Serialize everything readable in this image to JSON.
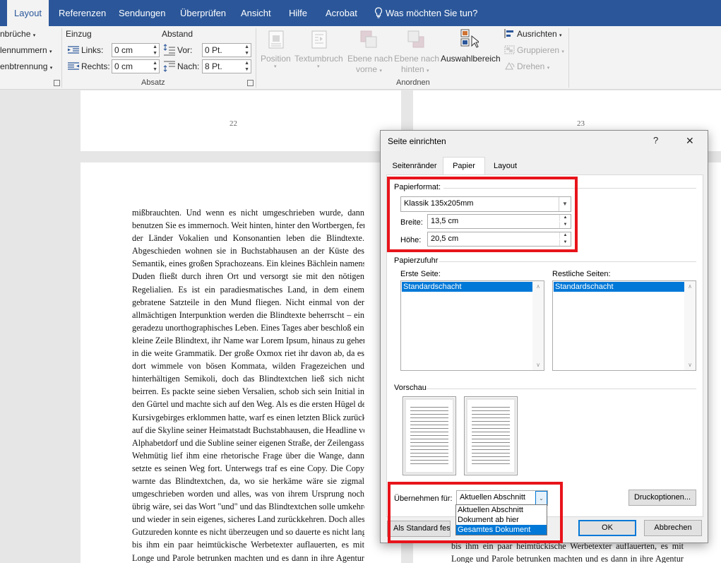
{
  "tabs": [
    {
      "label": "Layout",
      "active": true
    },
    {
      "label": "Referenzen"
    },
    {
      "label": "Sendungen"
    },
    {
      "label": "Überprüfen"
    },
    {
      "label": "Ansicht"
    },
    {
      "label": "Hilfe"
    },
    {
      "label": "Acrobat"
    }
  ],
  "tell_me": "Was möchten Sie tun?",
  "ribbon": {
    "left_items": [
      "nbrüche",
      "lennummern",
      "enbtrennung"
    ],
    "einzug_title": "Einzug",
    "abstand_title": "Abstand",
    "links_label": "Links:",
    "links_value": "0 cm",
    "rechts_label": "Rechts:",
    "rechts_value": "0 cm",
    "vor_label": "Vor:",
    "vor_value": "0 Pt.",
    "nach_label": "Nach:",
    "nach_value": "8 Pt.",
    "absatz_label": "Absatz",
    "position": "Position",
    "textumbruch": "Textumbruch",
    "ebene_vorne_1": "Ebene nach",
    "ebene_vorne_2": "vorne",
    "ebene_hinten_1": "Ebene nach",
    "ebene_hinten_2": "hinten",
    "auswahlbereich": "Auswahlbereich",
    "ausrichten": "Ausrichten",
    "gruppieren": "Gruppieren",
    "drehen": "Drehen",
    "anordnen_label": "Anordnen"
  },
  "doc": {
    "page_left": "22",
    "page_right": "23",
    "lines": [
      "mißbrauchten. Und wenn es nicht umgeschrieben wurde, dann",
      "benutzen Sie es immernoch. Weit hinten, hinter den Wortbergen, fern",
      "der Länder Vokalien und Konsonantien leben die Blindtexte.",
      "Abgeschieden wohnen sie in Buchstabhausen an der Küste des",
      "Semantik, eines großen Sprachozeans. Ein kleines Bächlein namens",
      "Duden fließt durch ihren Ort und versorgt sie mit den nötigen",
      "Regelialien. Es ist ein paradiesmatisches Land, in dem einem",
      "gebratene Satzteile in den Mund fliegen. Nicht einmal von der",
      "allmächtigen Interpunktion werden die Blindtexte beherrscht – ein",
      "geradezu unorthographisches Leben. Eines Tages aber beschloß eine",
      "kleine Zeile Blindtext, ihr Name war Lorem Ipsum, hinaus zu gehen",
      "in die weite Grammatik. Der große Oxmox riet ihr davon ab, da es",
      "dort wimmele von bösen Kommata, wilden Fragezeichen und",
      "hinterhältigen Semikoli, doch das Blindtextchen ließ sich nicht",
      "beirren. Es packte seine sieben Versalien, schob sich sein Initial in",
      "den Gürtel und machte sich auf den Weg. Als es die ersten Hügel des",
      "Kursivgebirges erklommen hatte, warf es einen letzten Blick zurück",
      "auf die Skyline seiner Heimatstadt Buchstabhausen, die Headline von",
      "Alphabetdorf und die Subline seiner eigenen Straße, der Zeilengasse.",
      "Wehmütig lief ihm eine rhetorische Frage über die Wange, dann",
      "setzte es seinen Weg fort. Unterwegs traf es eine Copy. Die Copy",
      "warnte das Blindtextchen, da, wo sie herkäme wäre sie zigmal",
      "umgeschrieben worden und alles, was von ihrem Ursprung noch",
      "übrig wäre, sei das Wort \"und\" und das Blindtextchen solle umkehren",
      "und wieder in sein eigenes, sicheres Land zurückkehren. Doch alles",
      "Gutzureden konnte es nicht überzeugen und so dauerte es nicht lange,",
      "bis ihm ein paar heimtückische Werbetexter auflauerten, es mit",
      "Longe und Parole betrunken machten und es dann in ihre Agentur"
    ],
    "right_lines": [
      "bis ihm ein paar heimtückische Werbetexter auflauerten, es mit",
      "Longe und Parole betrunken machten und es dann in ihre Agentur"
    ]
  },
  "dialog": {
    "title": "Seite einrichten",
    "help": "?",
    "close": "✕",
    "tabs": [
      "Seitenränder",
      "Papier",
      "Layout"
    ],
    "papierformat_label": "Papierformat:",
    "papierformat_value": "Klassik 135x205mm",
    "breite_label": "Breite:",
    "breite_value": "13,5 cm",
    "hoehe_label": "Höhe:",
    "hoehe_value": "20,5 cm",
    "papierzufuhr_label": "Papierzufuhr",
    "erste_seite_label": "Erste Seite:",
    "erste_seite_value": "Standardschacht",
    "restliche_label": "Restliche Seiten:",
    "restliche_value": "Standardschacht",
    "vorschau_label": "Vorschau",
    "uebernehmen_label": "Übernehmen für:",
    "uebernehmen_value": "Aktuellen Abschnitt",
    "uebernehmen_options": [
      "Aktuellen Abschnitt",
      "Dokument ab hier",
      "Gesamtes Dokument"
    ],
    "druckoptionen": "Druckoptionen...",
    "standard": "Als Standard festleg",
    "ok": "OK",
    "abbrechen": "Abbrechen"
  }
}
